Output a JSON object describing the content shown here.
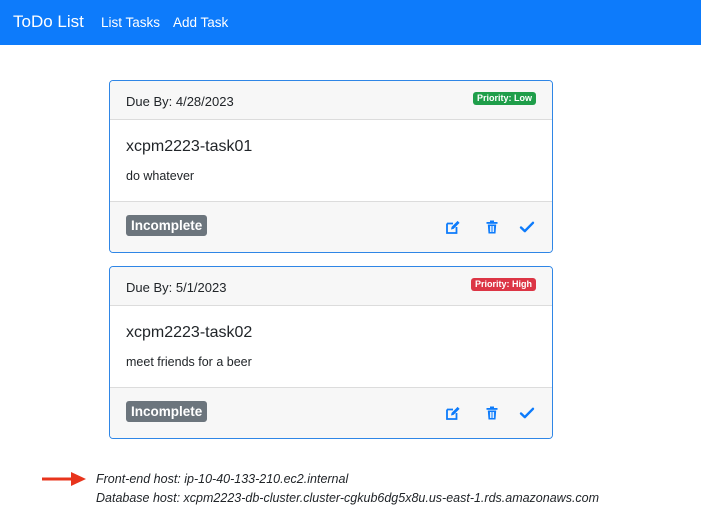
{
  "navbar": {
    "brand": "ToDo List",
    "links": [
      "List Tasks",
      "Add Task"
    ],
    "background_color": "#0d7bfb"
  },
  "tasks": [
    {
      "due": "Due By: 4/28/2023",
      "priority": "Priority: Low",
      "priority_color": "#1f9e4a",
      "title": "xcpm2223-task01",
      "description": "do whatever",
      "status": "Incomplete",
      "actions": [
        "edit-icon",
        "trash-icon",
        "check-icon"
      ]
    },
    {
      "due": "Due By: 5/1/2023",
      "priority": "Priority: High",
      "priority_color": "#dc3545",
      "title": "xcpm2223-task02",
      "description": "meet friends for a beer",
      "status": "Incomplete",
      "actions": [
        "edit-icon",
        "trash-icon",
        "check-icon"
      ]
    }
  ],
  "footer": {
    "arrow_color": "#e8341c",
    "frontend_host": "Front-end host: ip-10-40-133-210.ec2.internal",
    "database_host": "Database host: xcpm2223-db-cluster.cluster-cgkub6dg5x8u.us-east-1.rds.amazonaws.com"
  }
}
